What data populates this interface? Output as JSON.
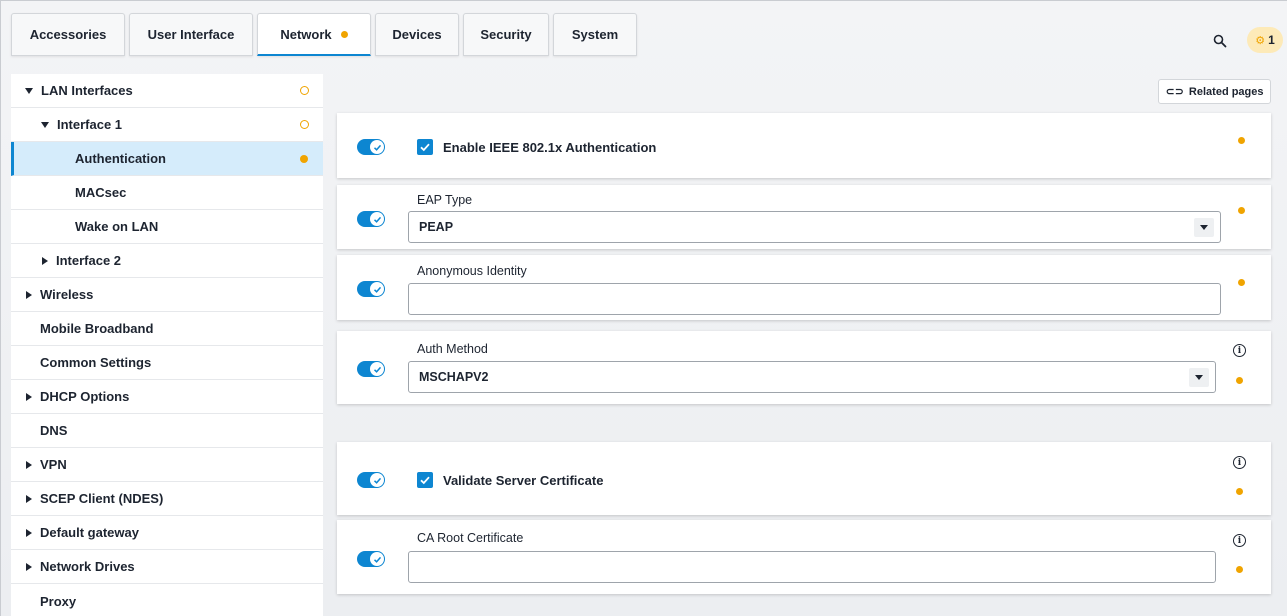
{
  "tabs": [
    {
      "label": "Accessories"
    },
    {
      "label": "User Interface"
    },
    {
      "label": "Network"
    },
    {
      "label": "Devices"
    },
    {
      "label": "Security"
    },
    {
      "label": "System"
    }
  ],
  "header": {
    "notification_count": "1"
  },
  "sidebar": {
    "items": [
      {
        "label": "LAN Interfaces"
      },
      {
        "label": "Interface 1"
      },
      {
        "label": "Authentication"
      },
      {
        "label": "MACsec"
      },
      {
        "label": "Wake on LAN"
      },
      {
        "label": "Interface 2"
      },
      {
        "label": "Wireless"
      },
      {
        "label": "Mobile Broadband"
      },
      {
        "label": "Common Settings"
      },
      {
        "label": "DHCP Options"
      },
      {
        "label": "DNS"
      },
      {
        "label": "VPN"
      },
      {
        "label": "SCEP Client (NDES)"
      },
      {
        "label": "Default gateway"
      },
      {
        "label": "Network Drives"
      },
      {
        "label": "Proxy"
      }
    ]
  },
  "main": {
    "related_pages_label": "Related pages",
    "enable_8021x": {
      "label": "Enable IEEE 802.1x Authentication",
      "checked": true,
      "enabled": true
    },
    "eap_type": {
      "label": "EAP Type",
      "value": "PEAP",
      "enabled": true
    },
    "anonymous_identity": {
      "label": "Anonymous Identity",
      "value": "",
      "enabled": true
    },
    "auth_method": {
      "label": "Auth Method",
      "value": "MSCHAPV2",
      "enabled": true
    },
    "validate_server_cert": {
      "label": "Validate Server Certificate",
      "checked": true,
      "enabled": true
    },
    "ca_root_cert": {
      "label": "CA Root Certificate",
      "value": "",
      "enabled": true
    }
  },
  "colors": {
    "accent": "#0d86d1",
    "modified_dot": "#f0a400",
    "selected_bg": "#d5ecfb"
  }
}
